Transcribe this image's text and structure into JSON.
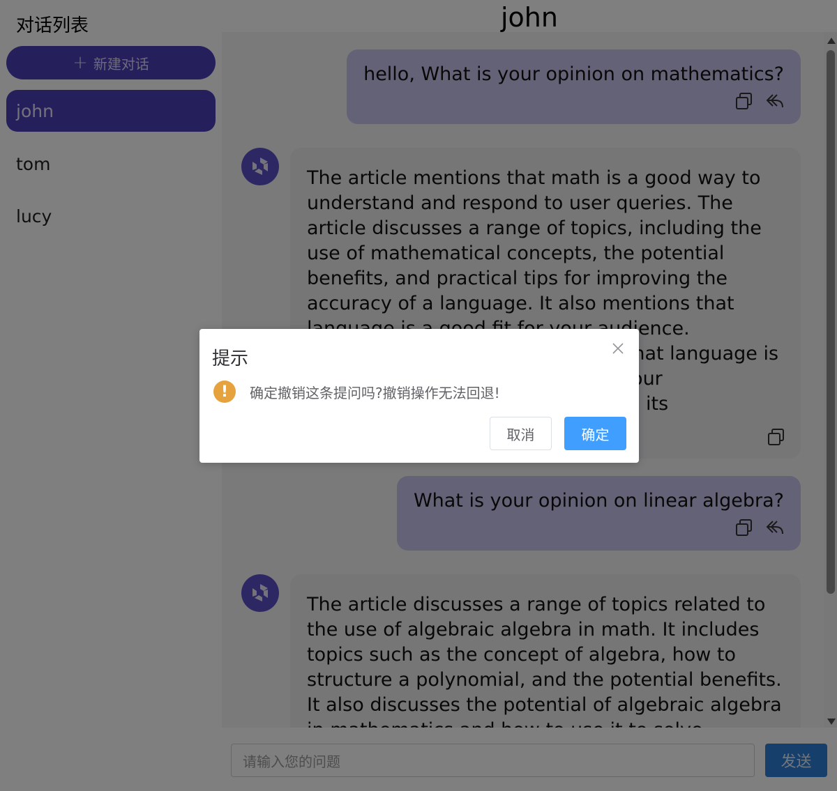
{
  "sidebar": {
    "title": "对话列表",
    "new_chat_label": "新建对话",
    "conversations": [
      {
        "label": "john",
        "active": true
      },
      {
        "label": "tom",
        "active": false
      },
      {
        "label": "lucy",
        "active": false
      }
    ]
  },
  "header": {
    "title": "john"
  },
  "messages": [
    {
      "role": "user",
      "text": "hello, What is your opinion on mathematics?",
      "actions": [
        "copy-icon",
        "reply-icon"
      ]
    },
    {
      "role": "assistant",
      "text": "The article mentions that math is a good way to understand and respond to user queries. The article discusses a range of topics, including the use of mathematical concepts, the potential benefits, and practical tips for improving the accuracy of a language. It also mentions that language is a good fit for your audience. Additionally, the article mentions that language is a valuable skill that can improve your understanding of the language and its",
      "actions": [
        "copy-icon"
      ]
    },
    {
      "role": "user",
      "text": "What is your opinion on linear algebra?",
      "actions": [
        "copy-icon",
        "reply-icon"
      ]
    },
    {
      "role": "assistant",
      "text": "The article discusses a range of topics related to the use of algebraic algebra in math. It includes topics such as the concept of algebra, how to structure a polynomial, and the potential benefits. It also discusses the potential of algebraic algebra in mathematics and how to use it to solve complex",
      "actions": []
    }
  ],
  "input": {
    "placeholder": "请输入您的问题",
    "send_label": "发送"
  },
  "dialog": {
    "title": "提示",
    "message": "确定撤销这条提问吗?撤销操作无法回退!",
    "cancel_label": "取消",
    "confirm_label": "确定",
    "icon": "warning-icon"
  },
  "colors": {
    "accent": "#4a3fb8",
    "user_bubble": "#c9c5ec",
    "bot_bubble": "#ececef",
    "confirm": "#409eff",
    "send": "#2f7fd9",
    "warning": "#e6a23c"
  }
}
